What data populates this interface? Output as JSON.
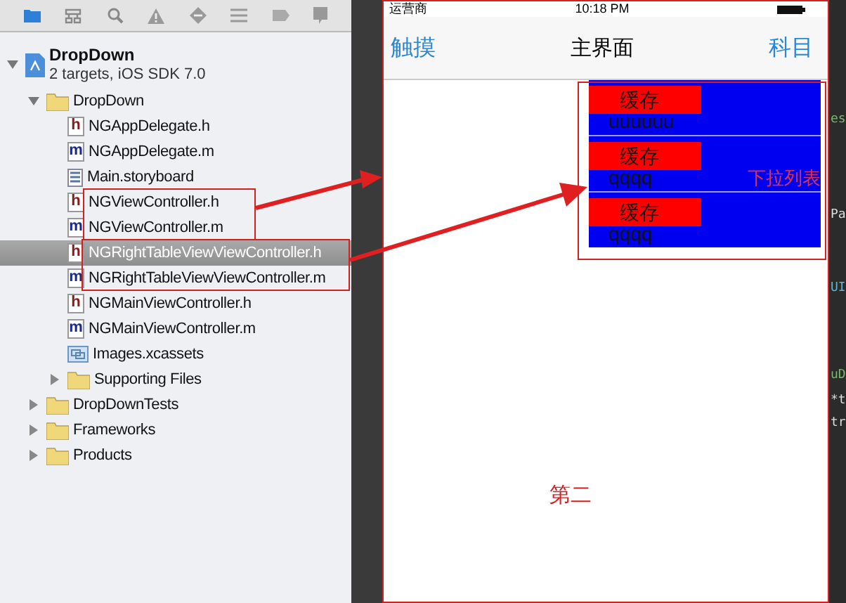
{
  "navigator": {
    "tree": [
      {
        "kind": "project",
        "label": "DropDown",
        "subtitle": "2 targets, iOS SDK 7.0",
        "expanded": true,
        "selected": false,
        "children": [
          {
            "kind": "folder",
            "label": "DropDown",
            "expanded": true,
            "selected": false,
            "children": [
              {
                "kind": "header",
                "badge": "h",
                "label": "NGAppDelegate.h",
                "selected": false
              },
              {
                "kind": "source",
                "badge": "m",
                "label": "NGAppDelegate.m",
                "selected": false
              },
              {
                "kind": "storyboard",
                "label": "Main.storyboard",
                "selected": false
              },
              {
                "kind": "header",
                "badge": "h",
                "label": "NGViewController.h",
                "selected": false
              },
              {
                "kind": "source",
                "badge": "m",
                "label": "NGViewController.m",
                "selected": false
              },
              {
                "kind": "header",
                "badge": "h",
                "label": "NGRightTableViewViewController.h",
                "selected": true
              },
              {
                "kind": "source",
                "badge": "m",
                "label": "NGRightTableViewViewController.m",
                "selected": false
              },
              {
                "kind": "header",
                "badge": "h",
                "label": "NGMainViewController.h",
                "selected": false
              },
              {
                "kind": "source",
                "badge": "m",
                "label": "NGMainViewController.m",
                "selected": false
              },
              {
                "kind": "assets",
                "label": "Images.xcassets",
                "selected": false
              },
              {
                "kind": "folder",
                "label": "Supporting Files",
                "expanded": false,
                "selected": false
              }
            ]
          },
          {
            "kind": "folder",
            "label": "DropDownTests",
            "expanded": false,
            "selected": false
          },
          {
            "kind": "folder",
            "label": "Frameworks",
            "expanded": false,
            "selected": false
          },
          {
            "kind": "folder",
            "label": "Products",
            "expanded": false,
            "selected": false
          }
        ]
      }
    ]
  },
  "simulator": {
    "status_bar": {
      "carrier": "运营商",
      "time": "10:18 PM"
    },
    "nav_bar": {
      "left_button": "触摸",
      "title": "主界面",
      "right_button": "科目"
    },
    "dropdown": {
      "rows": [
        {
          "label": "缓存",
          "detail": "uuuuuu"
        },
        {
          "label": "缓存",
          "detail": "qqqq"
        },
        {
          "label": "缓存",
          "detail": "qqqq"
        }
      ],
      "side_label": "下拉列表"
    },
    "body_label": "第二"
  },
  "editor": {
    "fragments": [
      {
        "text": "es",
        "kind": "string"
      },
      {
        "text": "Pa",
        "kind": "plain"
      },
      {
        "text": "UI",
        "kind": "type"
      },
      {
        "text": "uD",
        "kind": "string"
      },
      {
        "text": "*t",
        "kind": "plain"
      },
      {
        "text": "tr",
        "kind": "plain"
      }
    ]
  }
}
